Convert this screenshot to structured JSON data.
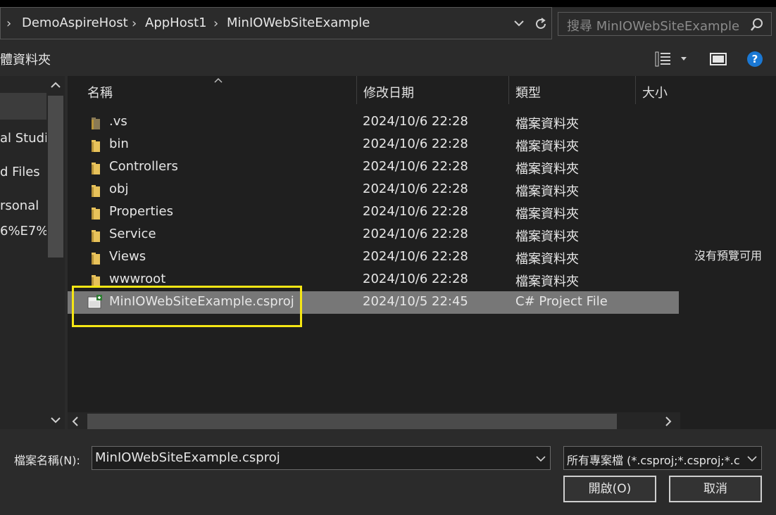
{
  "breadcrumb": {
    "items": [
      "DemoAspireHost",
      "AppHost1",
      "MinIOWebSiteExample"
    ]
  },
  "search": {
    "placeholder": "搜尋 MinIOWebSiteExample"
  },
  "toolbar": {
    "new_folder_label": "體資料夾"
  },
  "nav": {
    "items": [
      "al Studi",
      "d Files",
      "rsonal",
      "6%E7%8"
    ]
  },
  "columns": {
    "name": "名稱",
    "modified": "修改日期",
    "type": "類型",
    "size": "大小"
  },
  "files": [
    {
      "name": ".vs",
      "modified": "2024/10/6 22:28",
      "type": "檔案資料夾",
      "icon": "folder-icon"
    },
    {
      "name": "bin",
      "modified": "2024/10/6 22:28",
      "type": "檔案資料夾",
      "icon": "folder-icon"
    },
    {
      "name": "Controllers",
      "modified": "2024/10/6 22:28",
      "type": "檔案資料夾",
      "icon": "folder-icon"
    },
    {
      "name": "obj",
      "modified": "2024/10/6 22:28",
      "type": "檔案資料夾",
      "icon": "folder-icon"
    },
    {
      "name": "Properties",
      "modified": "2024/10/6 22:28",
      "type": "檔案資料夾",
      "icon": "folder-icon"
    },
    {
      "name": "Service",
      "modified": "2024/10/6 22:28",
      "type": "檔案資料夾",
      "icon": "folder-icon"
    },
    {
      "name": "Views",
      "modified": "2024/10/6 22:28",
      "type": "檔案資料夾",
      "icon": "folder-icon"
    },
    {
      "name": "wwwroot",
      "modified": "2024/10/6 22:28",
      "type": "檔案資料夾",
      "icon": "folder-icon"
    },
    {
      "name": "MinIOWebSiteExample.csproj",
      "modified": "2024/10/5 22:45",
      "type": "C# Project File",
      "icon": "csproj-file-icon",
      "selected": true
    }
  ],
  "preview": {
    "empty_text": "沒有預覽可用"
  },
  "footer": {
    "filename_label": "檔案名稱(N):",
    "filename_value": "MinIOWebSiteExample.csproj",
    "filetype_value": "所有專案檔 (*.csproj;*.csproj;*.c",
    "open_label": "開啟(O)",
    "cancel_label": "取消"
  },
  "colors": {
    "highlight_box": "#f5e614",
    "selected_row": "#777777",
    "folder": "#e8c25a",
    "help": "#1a78d4"
  }
}
